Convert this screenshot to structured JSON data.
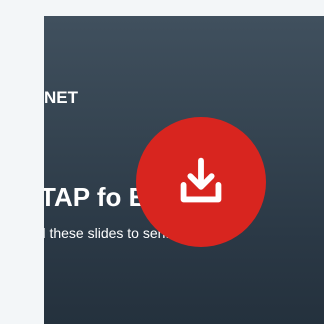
{
  "thumbnail": {
    "logo_text": "NET",
    "title": "TAP fo                 Elev",
    "subtitle": "dd these slides to         sentation a"
  },
  "download_button": {
    "icon": "download-icon",
    "color": "#d8251f"
  },
  "colors": {
    "page_background": "#f3f6f8",
    "slide_background": "#33424f",
    "text": "#ffffff"
  }
}
